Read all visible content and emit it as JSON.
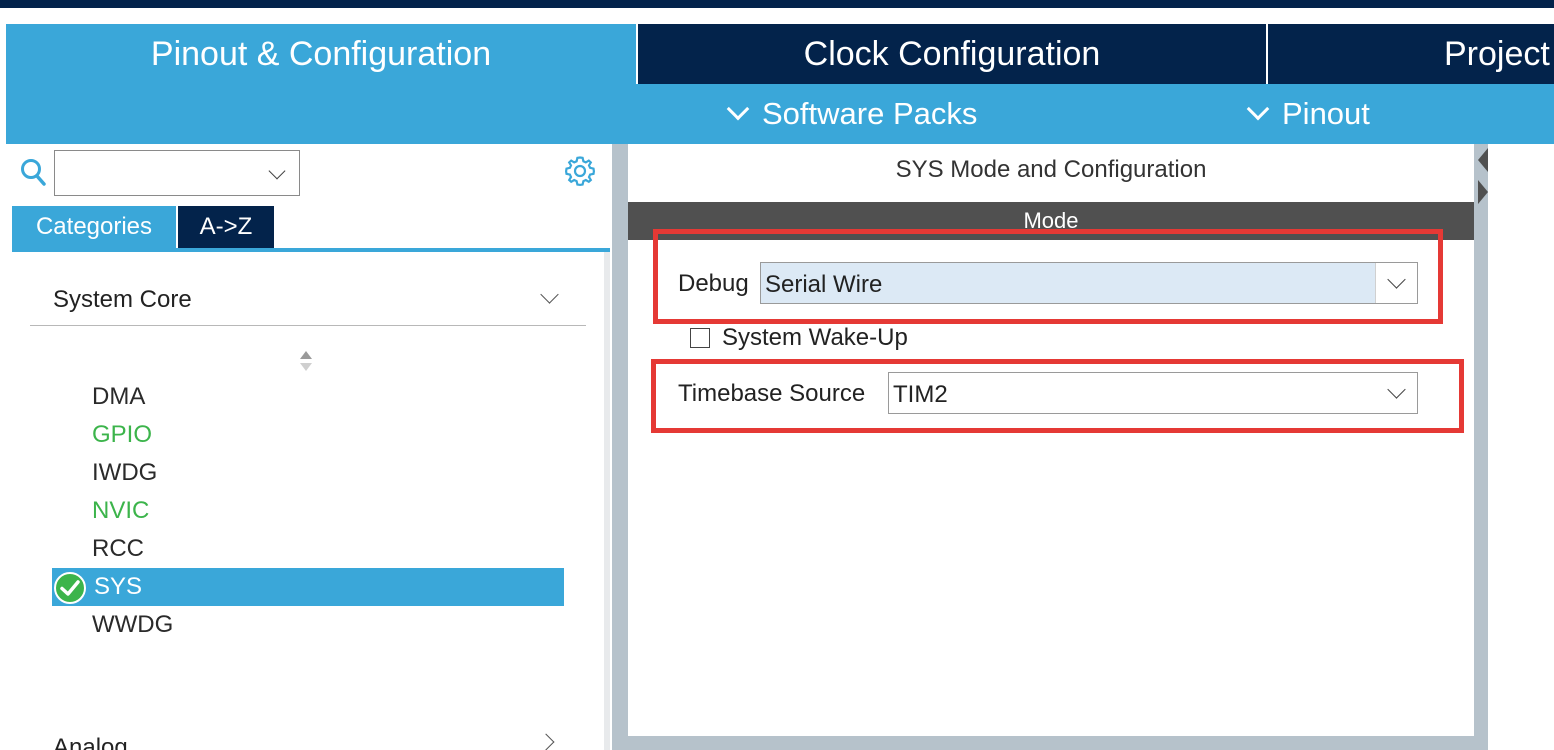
{
  "tabs": {
    "pinout": "Pinout & Configuration",
    "clock": "Clock Configuration",
    "project": "Project"
  },
  "subbar": {
    "software_packs": "Software Packs",
    "pinout": "Pinout"
  },
  "left_panel": {
    "search": {
      "value": "",
      "placeholder": ""
    },
    "tabs": {
      "categories": "Categories",
      "az": "A->Z"
    },
    "category_header": "System Core",
    "items": [
      {
        "label": "DMA",
        "status": "normal"
      },
      {
        "label": "GPIO",
        "status": "configured"
      },
      {
        "label": "IWDG",
        "status": "normal"
      },
      {
        "label": "NVIC",
        "status": "configured"
      },
      {
        "label": "RCC",
        "status": "normal"
      },
      {
        "label": "SYS",
        "status": "selected"
      },
      {
        "label": "WWDG",
        "status": "normal"
      }
    ],
    "next_category": "Analog"
  },
  "right_panel": {
    "title": "SYS Mode and Configuration",
    "mode_header": "Mode",
    "debug": {
      "label": "Debug",
      "value": "Serial Wire"
    },
    "wakeup": {
      "label": "System Wake-Up",
      "checked": false
    },
    "timebase": {
      "label": "Timebase Source",
      "value": "TIM2"
    }
  },
  "colors": {
    "accent_blue": "#3aa7d9",
    "navy": "#03234b",
    "highlight_red": "#e53935",
    "configured_green": "#3cb44b",
    "mode_bar": "#505050"
  }
}
